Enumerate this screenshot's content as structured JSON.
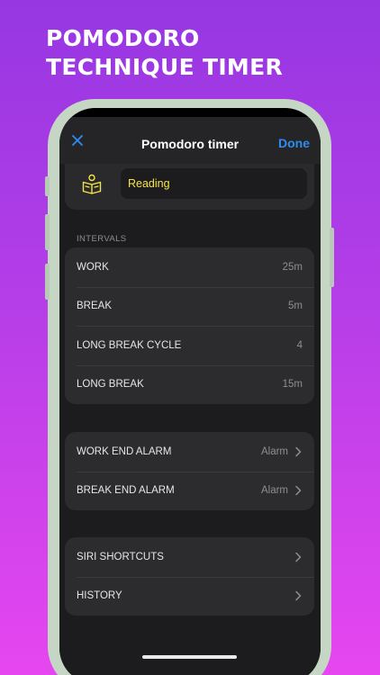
{
  "headline": {
    "line1": "POMODORO",
    "line2": "TECHNIQUE TIMER"
  },
  "nav": {
    "title": "Pomodoro timer",
    "done_label": "Done",
    "close_icon": "close-icon"
  },
  "task": {
    "icon": "reading-icon",
    "name": "Reading"
  },
  "intervals": {
    "section_label": "INTERVALS",
    "rows": [
      {
        "label": "WORK",
        "value": "25m"
      },
      {
        "label": "BREAK",
        "value": "5m"
      },
      {
        "label": "LONG BREAK CYCLE",
        "value": "4"
      },
      {
        "label": "LONG BREAK",
        "value": "15m"
      }
    ]
  },
  "alarms": {
    "rows": [
      {
        "label": "WORK END ALARM",
        "value": "Alarm"
      },
      {
        "label": "BREAK END ALARM",
        "value": "Alarm"
      }
    ]
  },
  "extras": {
    "rows": [
      {
        "label": "SIRI SHORTCUTS"
      },
      {
        "label": "HISTORY"
      }
    ]
  },
  "colors": {
    "accent": "#2f8cf0",
    "task_text": "#f7e44a",
    "background_top": "#9637e2",
    "background_bottom": "#e646ef"
  }
}
